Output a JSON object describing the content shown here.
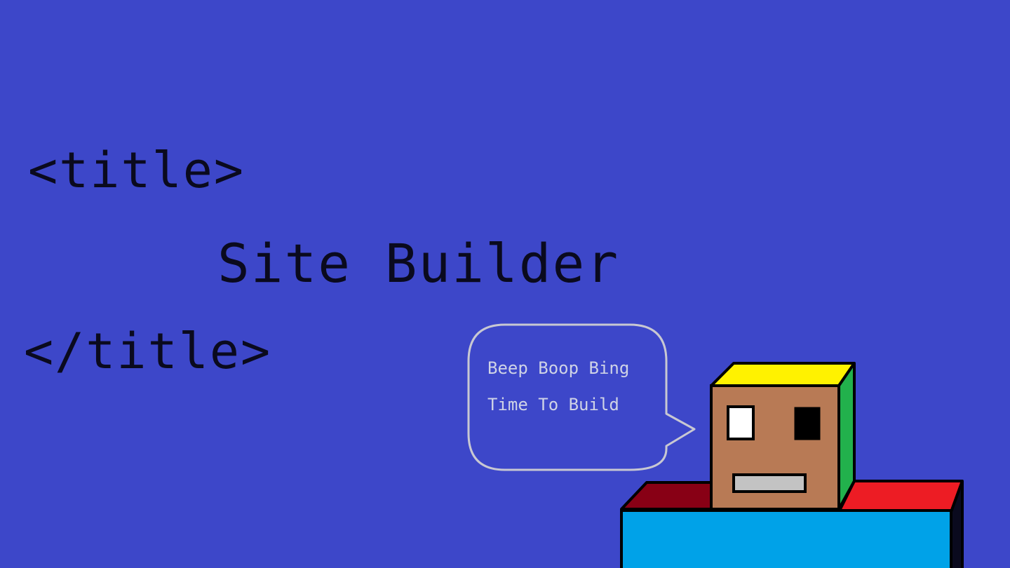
{
  "title_block": {
    "open_tag": "<title>",
    "site_name": "Site Builder",
    "close_tag": "</title>"
  },
  "speech_bubble": {
    "line_1": "Beep Boop Bing",
    "line_2": "Time To Build"
  },
  "colors": {
    "background": "#3d47c9",
    "text": "#0a0a1e",
    "bubble_stroke": "#c8c8d2",
    "head_face": "#b87a55",
    "head_top": "#fff200",
    "head_side": "#22b14c",
    "body_front": "#00a2e8",
    "shoulder_left": "#880015",
    "shoulder_right": "#ed1c24",
    "mouth": "#c3c3c3"
  }
}
